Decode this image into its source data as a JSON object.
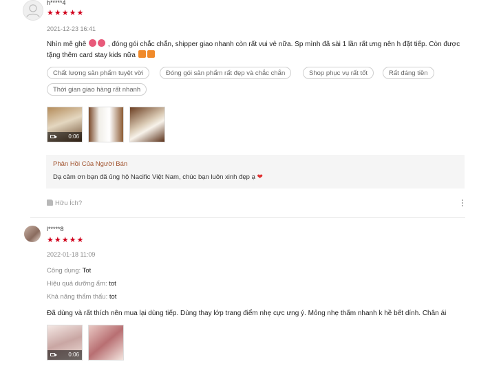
{
  "review1": {
    "username": "h*****4",
    "stars": "★★★★★",
    "date": "2021-12-23 16:41",
    "text_line1": "Nhìn mê ghê",
    "text_line1b": ", đóng gói chắc chắn, shipper giao nhanh còn rất vui vẻ nữa. Sp mình đã sài 1 lần rất ưng nên h đặt tiếp. Còn được",
    "text_line2": "tặng thêm card stay kids nữa",
    "tags": [
      "Chất lượng sản phẩm tuyệt vời",
      "Đóng gói sản phẩm rất đẹp và chắc chắn",
      "Shop phục vụ rất tốt",
      "Rất đáng tiền",
      "Thời gian giao hàng rất nhanh"
    ],
    "video_duration": "0:06",
    "seller_reply": {
      "title": "Phản Hồi Của Người Bán",
      "text": "Dạ cảm ơn bạn đã ủng hộ Nacific Việt Nam, chúc bạn luôn xinh đẹp ạ"
    },
    "helpful_label": "Hữu Ích?"
  },
  "review2": {
    "username": "l*****8",
    "stars": "★★★★★",
    "date": "2022-01-18 11:09",
    "attributes": [
      {
        "key": "Công dụng:",
        "value": "Tot"
      },
      {
        "key": "Hiệu quả dưỡng ẩm:",
        "value": "tot"
      },
      {
        "key": "Khả năng thẩm thấu:",
        "value": "tot"
      }
    ],
    "text": "Đã dùng và rất thích nên mua lại dùng tiếp. Dùng thay lớp trang điểm nhẹ cực ưng ý. Mỏng nhẹ thấm nhanh k hề bết dính. Chân ái",
    "video_duration": "0:06"
  },
  "colors": {
    "star": "#d0011b",
    "seller_title": "#a0522d",
    "muted": "#8a8a8a"
  },
  "icons": [
    "user-avatar-icon",
    "camera-icon",
    "thumbs-up-icon",
    "more-vertical-icon",
    "heart-icon"
  ]
}
